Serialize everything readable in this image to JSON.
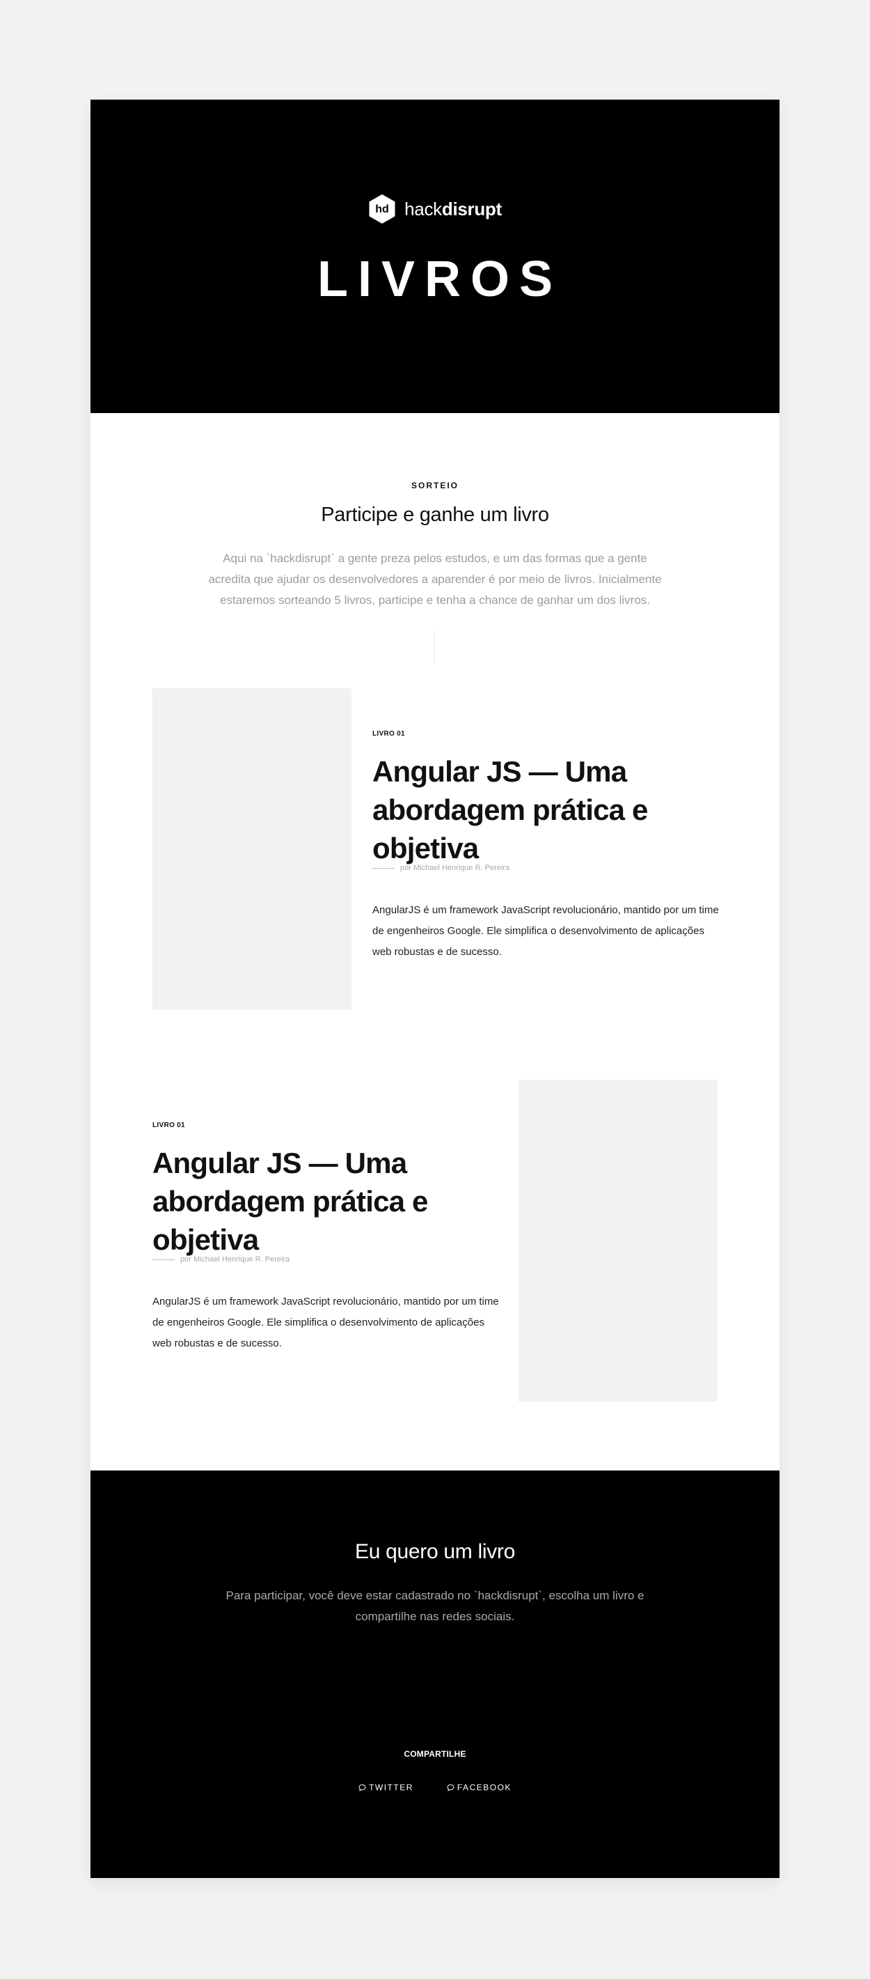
{
  "brand": {
    "badge_text": "hd",
    "name_light": "hack",
    "name_bold": "disrupt"
  },
  "hero": {
    "title": "LIVROS"
  },
  "intro": {
    "eyebrow": "SORTEIO",
    "title": "Participe e ganhe um livro",
    "text": "Aqui na `hackdisrupt` a gente preza pelos estudos, e um das formas que a gente acredita que ajudar os desenvolvedores a aparender é por meio de livros. Inicialmente estaremos sorteando 5 livros, participe e tenha a chance de ganhar um dos livros."
  },
  "books": [
    {
      "label": "LIVRO 01",
      "title": "Angular JS — Uma abordagem prática e objetiva",
      "author": "por Michael Henrique R. Pereira",
      "description": "AngularJS é um framework JavaScript revolucionário, mantido por um time de engenheiros Google. Ele simplifica o desenvolvimento de aplicações web robustas e de sucesso."
    },
    {
      "label": "LIVRO 01",
      "title": "Angular JS — Uma abordagem prática e objetiva",
      "author": "por Michael Henrique R. Pereira",
      "description": "AngularJS é um framework JavaScript revolucionário, mantido por um time de engenheiros Google. Ele simplifica o desenvolvimento de aplicações web robustas e de sucesso."
    }
  ],
  "cta": {
    "title": "Eu quero um livro",
    "text": "Para participar, você deve estar cadastrado no `hackdisrupt`, escolha um livro e compartilhe nas redes sociais."
  },
  "share": {
    "label": "COMPARTILHE",
    "links": [
      {
        "label": "TWITTER",
        "icon": "chat-bubble-icon"
      },
      {
        "label": "FACEBOOK",
        "icon": "chat-bubble-icon"
      }
    ]
  },
  "colors": {
    "page_background": "#f2f2f2",
    "dark": "#000000",
    "muted_text": "#9c9c9c",
    "cover_placeholder": "#f2f2f2"
  }
}
